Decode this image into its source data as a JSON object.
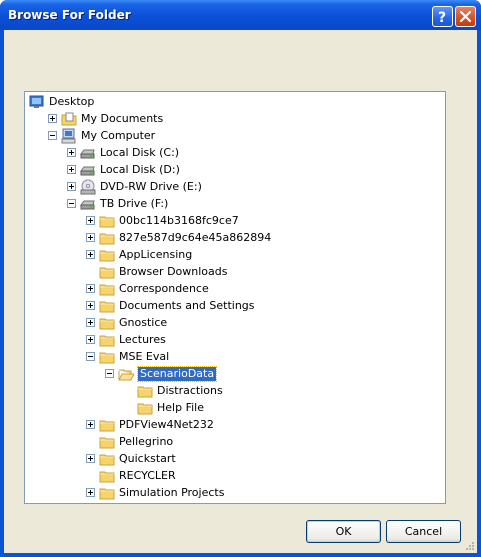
{
  "window": {
    "title": "Browse For Folder",
    "help_glyph": "?",
    "colors": {
      "titlebar": "#0a4fd6",
      "face": "#ece9d8",
      "selection": "#316ac5"
    }
  },
  "tree": {
    "items": [
      {
        "label": "Desktop",
        "icon": "desktop-icon",
        "toggle": "none"
      },
      {
        "label": "My Documents",
        "icon": "documents-folder-icon",
        "toggle": "plus"
      },
      {
        "label": "My Computer",
        "icon": "computer-icon",
        "toggle": "minus"
      },
      {
        "label": "Local Disk (C:)",
        "icon": "drive-icon",
        "toggle": "plus"
      },
      {
        "label": "Local Disk (D:)",
        "icon": "drive-icon",
        "toggle": "plus"
      },
      {
        "label": "DVD-RW Drive (E:)",
        "icon": "dvd-icon",
        "toggle": "plus"
      },
      {
        "label": "TB Drive (F:)",
        "icon": "drive-icon",
        "toggle": "minus"
      },
      {
        "label": "00bc114b3168fc9ce7",
        "icon": "folder-icon",
        "toggle": "plus"
      },
      {
        "label": "827e587d9c64e45a862894",
        "icon": "folder-icon",
        "toggle": "plus"
      },
      {
        "label": "AppLicensing",
        "icon": "folder-icon",
        "toggle": "plus"
      },
      {
        "label": "Browser Downloads",
        "icon": "folder-icon",
        "toggle": "none"
      },
      {
        "label": "Correspondence",
        "icon": "folder-icon",
        "toggle": "plus"
      },
      {
        "label": "Documents and Settings",
        "icon": "folder-icon",
        "toggle": "plus"
      },
      {
        "label": "Gnostice",
        "icon": "folder-icon",
        "toggle": "plus"
      },
      {
        "label": "Lectures",
        "icon": "folder-icon",
        "toggle": "plus"
      },
      {
        "label": "MSE Eval",
        "icon": "folder-icon",
        "toggle": "minus"
      },
      {
        "label": "ScenarioData",
        "icon": "open-folder-icon",
        "toggle": "minus",
        "selected": true
      },
      {
        "label": "Distractions",
        "icon": "folder-icon",
        "toggle": "none"
      },
      {
        "label": "Help File",
        "icon": "folder-icon",
        "toggle": "none"
      },
      {
        "label": "PDFView4Net232",
        "icon": "folder-icon",
        "toggle": "plus"
      },
      {
        "label": "Pellegrino",
        "icon": "folder-icon",
        "toggle": "none"
      },
      {
        "label": "Quickstart",
        "icon": "folder-icon",
        "toggle": "plus"
      },
      {
        "label": "RECYCLER",
        "icon": "folder-icon",
        "toggle": "none"
      },
      {
        "label": "Simulation Projects",
        "icon": "folder-icon",
        "toggle": "plus"
      }
    ]
  },
  "buttons": {
    "ok": "OK",
    "cancel": "Cancel"
  }
}
